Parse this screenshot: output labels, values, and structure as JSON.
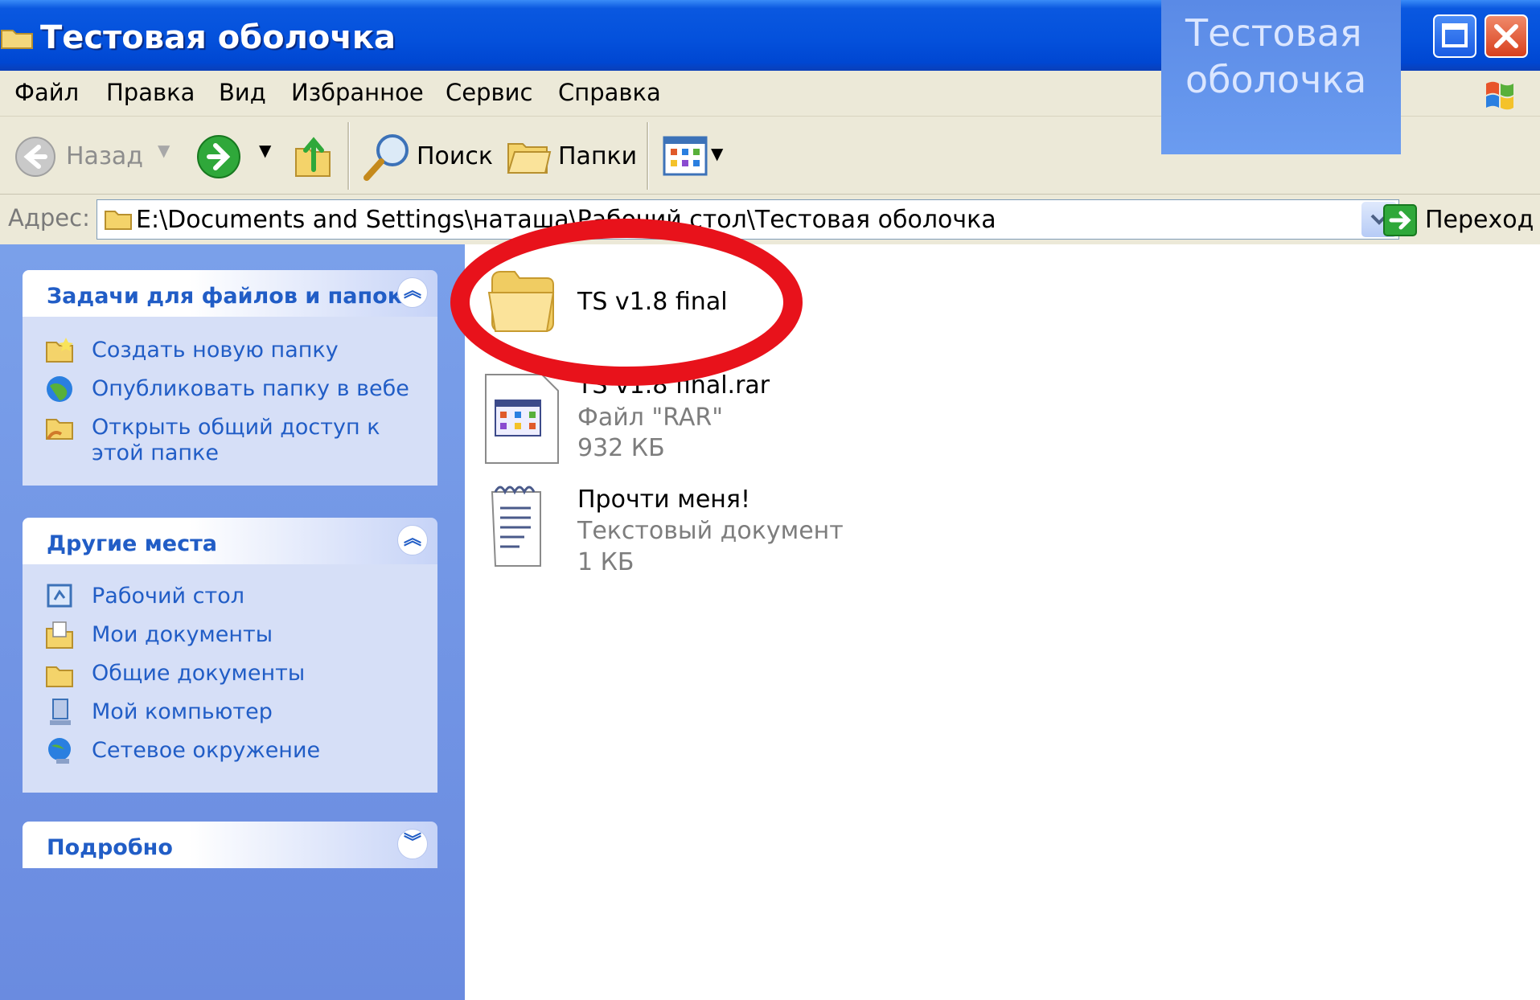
{
  "window": {
    "title": "Тестовая оболочка",
    "overlay_caption": "Тестовая\nоболочка",
    "accent": "#0451dc"
  },
  "menu": [
    "Файл",
    "Правка",
    "Вид",
    "Избранное",
    "Сервис",
    "Справка"
  ],
  "toolbar": {
    "back_label": "Назад",
    "search_label": "Поиск",
    "folders_label": "Папки"
  },
  "address": {
    "label": "Адрес:",
    "path": "E:\\Documents and Settings\\наташа\\Рабочий стол\\Тестовая оболочка",
    "go_label": "Переход"
  },
  "tasks_panel": {
    "title": "Задачи для файлов и папок",
    "items": [
      {
        "label": "Создать новую папку",
        "icon": "new-folder-icon"
      },
      {
        "label": "Опубликовать папку в вебе",
        "icon": "globe-icon"
      },
      {
        "label": "Открыть общий доступ к этой папке",
        "icon": "share-folder-icon"
      }
    ]
  },
  "places_panel": {
    "title": "Другие места",
    "items": [
      {
        "label": "Рабочий стол",
        "icon": "desktop-icon"
      },
      {
        "label": "Мои документы",
        "icon": "documents-icon"
      },
      {
        "label": "Общие документы",
        "icon": "shared-documents-icon"
      },
      {
        "label": "Мой компьютер",
        "icon": "computer-icon"
      },
      {
        "label": "Сетевое окружение",
        "icon": "network-icon"
      }
    ]
  },
  "details_panel": {
    "title": "Подробно"
  },
  "files": [
    {
      "name": "TS v1.8 final",
      "icon": "folder-icon"
    },
    {
      "name": "TS v1.8 final.rar",
      "type": "Файл \"RAR\"",
      "size": "932 КБ",
      "icon": "rar-archive-icon"
    },
    {
      "name": "Прочти меня!",
      "type": "Текстовый документ",
      "size": "1 КБ",
      "icon": "text-document-icon"
    }
  ],
  "annotation": {
    "color": "#e8121b"
  }
}
